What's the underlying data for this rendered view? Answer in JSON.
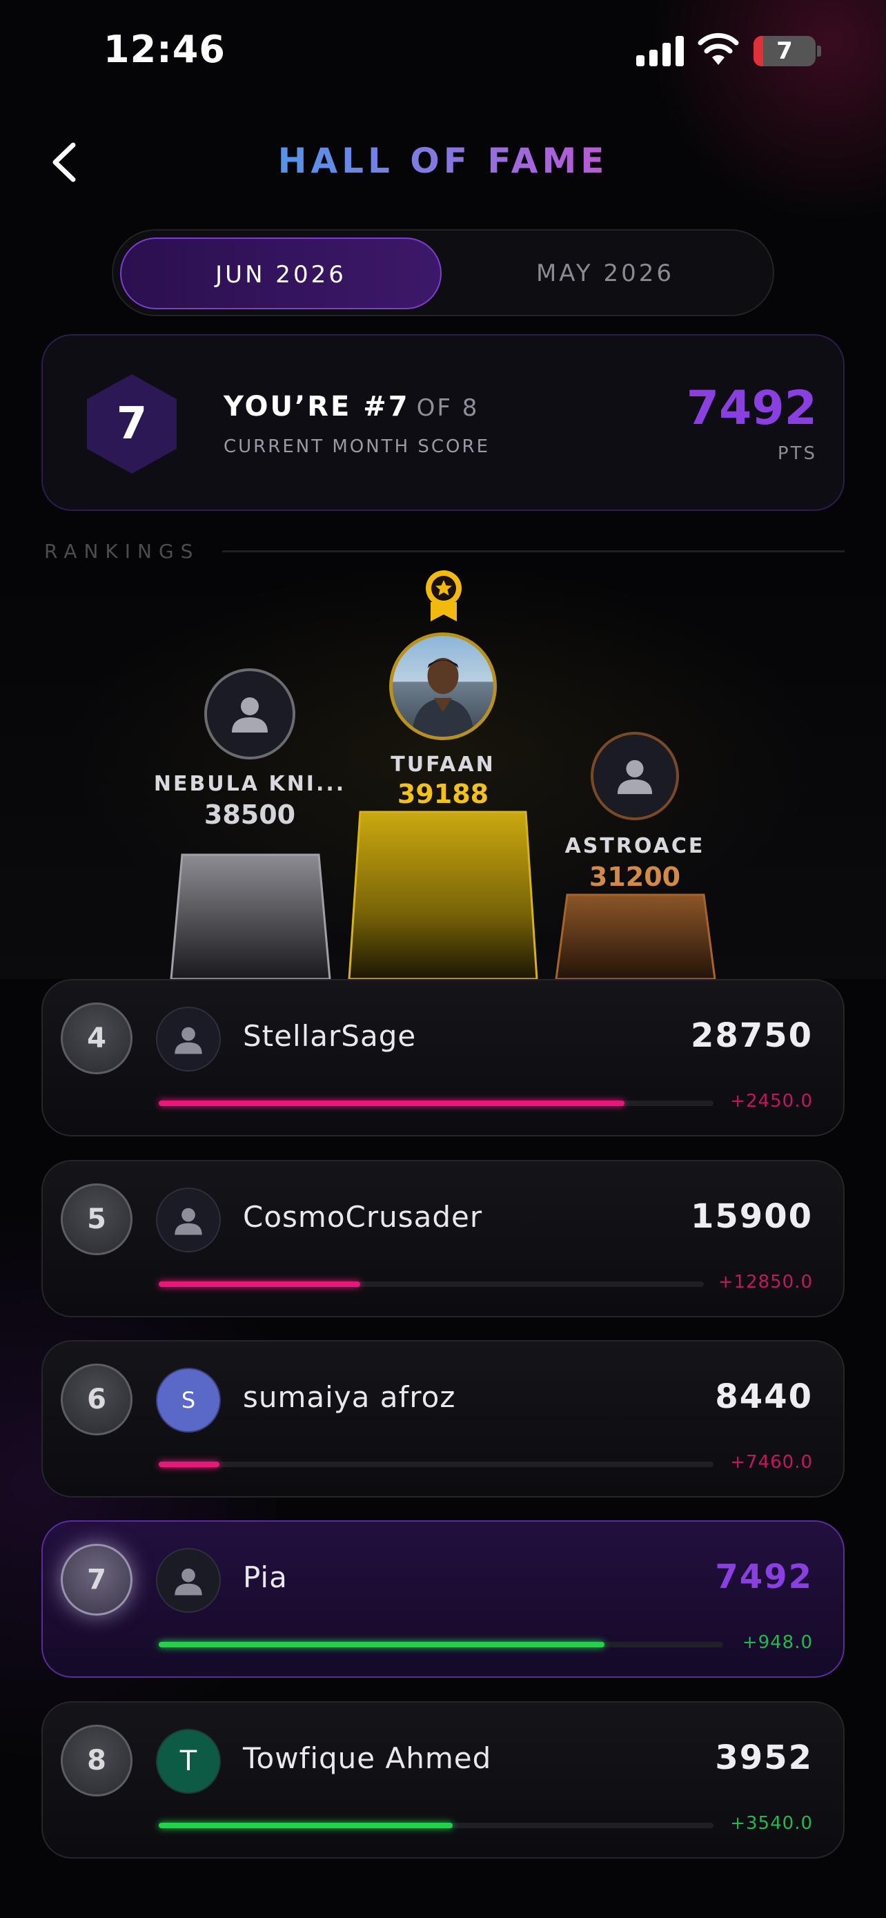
{
  "status_bar": {
    "time": "12:46",
    "battery": "7"
  },
  "header": {
    "title": "HALL OF FAME"
  },
  "tabs": [
    {
      "label": "JUN 2026",
      "active": true
    },
    {
      "label": "MAY 2026",
      "active": false
    }
  ],
  "my_rank": {
    "rank": "7",
    "headline": "YOU’RE #7",
    "of_text": "OF 8",
    "subtitle": "CURRENT MONTH SCORE",
    "score": "7492",
    "unit": "PTS"
  },
  "rankings_label": "RANKINGS",
  "podium": {
    "first": {
      "name": "TUFAAN",
      "score": "39188"
    },
    "second": {
      "name": "NEBULA KNI...",
      "score": "38500"
    },
    "third": {
      "name": "ASTROACE",
      "score": "31200"
    }
  },
  "list": [
    {
      "rank": "4",
      "name": "StellarSage",
      "score": "28750",
      "delta": "+2450.0",
      "progress": 0.84,
      "avatar_letter": "",
      "bar_color": "#e8187a"
    },
    {
      "rank": "5",
      "name": "CosmoCrusader",
      "score": "15900",
      "delta": "+12850.0",
      "progress": 0.37,
      "avatar_letter": "",
      "bar_color": "#e8187a"
    },
    {
      "rank": "6",
      "name": "sumaiya afroz",
      "score": "8440",
      "delta": "+7460.0",
      "progress": 0.11,
      "avatar_letter": "S",
      "bar_color": "#e8187a"
    },
    {
      "rank": "7",
      "name": "Pia",
      "score": "7492",
      "delta": "+948.0",
      "progress": 0.79,
      "avatar_letter": "",
      "bar_color": "#22d34a",
      "is_me": true
    },
    {
      "rank": "8",
      "name": "Towfique Ahmed",
      "score": "3952",
      "delta": "+3540.0",
      "progress": 0.53,
      "avatar_letter": "T",
      "bar_color": "#22d34a"
    }
  ],
  "colors": {
    "accent": "#8a3fe0",
    "gold": "#f2c11a",
    "silver": "#9a9aa2",
    "bronze": "#c9793a",
    "negative_delta": "#c0185f",
    "positive_delta": "#22b84a"
  }
}
